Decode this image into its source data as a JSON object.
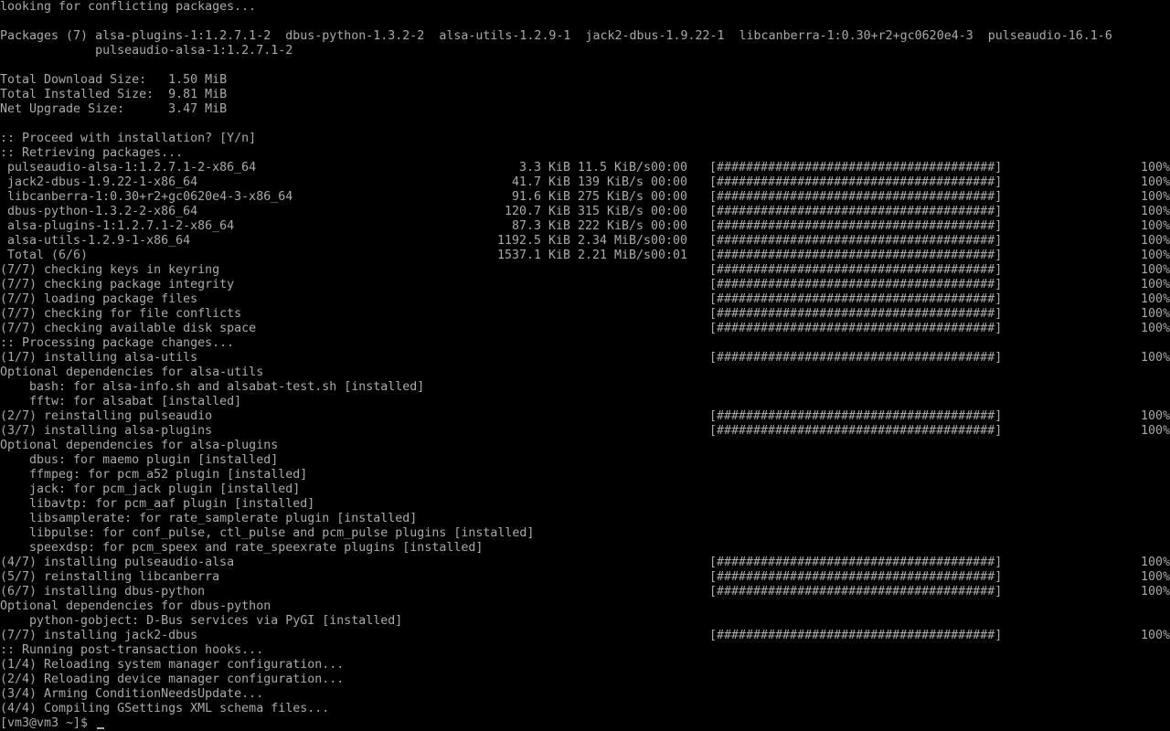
{
  "bar": "[######################################]",
  "bar_pct": "100%",
  "prompt": "[vm3@vm3 ~]$ ",
  "lines": [
    {
      "kind": "text",
      "text": "looking for conflicting packages..."
    },
    {
      "kind": "blank"
    },
    {
      "kind": "text",
      "text": "Packages (7) alsa-plugins-1:1.2.7.1-2  dbus-python-1.3.2-2  alsa-utils-1.2.9-1  jack2-dbus-1.9.22-1  libcanberra-1:0.30+r2+gc0620e4-3  pulseaudio-16.1-6"
    },
    {
      "kind": "text",
      "text": "             pulseaudio-alsa-1:1.2.7.1-2"
    },
    {
      "kind": "blank"
    },
    {
      "kind": "text",
      "text": "Total Download Size:   1.50 MiB"
    },
    {
      "kind": "text",
      "text": "Total Installed Size:  9.81 MiB"
    },
    {
      "kind": "text",
      "text": "Net Upgrade Size:      3.47 MiB"
    },
    {
      "kind": "blank"
    },
    {
      "kind": "text",
      "text": ":: Proceed with installation? [Y/n]"
    },
    {
      "kind": "text",
      "text": ":: Retrieving packages..."
    },
    {
      "kind": "dl",
      "name": " pulseaudio-alsa-1:1.2.7.1-2-x86_64",
      "size": "3.3 KiB",
      "rate": "11.5 KiB/s",
      "time": "00:00"
    },
    {
      "kind": "dl",
      "name": " jack2-dbus-1.9.22-1-x86_64",
      "size": "41.7 KiB",
      "rate": "139 KiB/s",
      "time": "00:00"
    },
    {
      "kind": "dl",
      "name": " libcanberra-1:0.30+r2+gc0620e4-3-x86_64",
      "size": "91.6 KiB",
      "rate": "275 KiB/s",
      "time": "00:00"
    },
    {
      "kind": "dl",
      "name": " dbus-python-1.3.2-2-x86_64",
      "size": "120.7 KiB",
      "rate": "315 KiB/s",
      "time": "00:00"
    },
    {
      "kind": "dl",
      "name": " alsa-plugins-1:1.2.7.1-2-x86_64",
      "size": "87.3 KiB",
      "rate": "222 KiB/s",
      "time": "00:00"
    },
    {
      "kind": "dl",
      "name": " alsa-utils-1.2.9-1-x86_64",
      "size": "1192.5 KiB",
      "rate": "2.34 MiB/s",
      "time": "00:00"
    },
    {
      "kind": "dl",
      "name": " Total (6/6)",
      "size": "1537.1 KiB",
      "rate": "2.21 MiB/s",
      "time": "00:01"
    },
    {
      "kind": "step",
      "text": "(7/7) checking keys in keyring"
    },
    {
      "kind": "step",
      "text": "(7/7) checking package integrity"
    },
    {
      "kind": "step",
      "text": "(7/7) loading package files"
    },
    {
      "kind": "step",
      "text": "(7/7) checking for file conflicts"
    },
    {
      "kind": "step",
      "text": "(7/7) checking available disk space"
    },
    {
      "kind": "text",
      "text": ":: Processing package changes..."
    },
    {
      "kind": "step",
      "text": "(1/7) installing alsa-utils"
    },
    {
      "kind": "text",
      "text": "Optional dependencies for alsa-utils"
    },
    {
      "kind": "text",
      "text": "    bash: for alsa-info.sh and alsabat-test.sh [installed]"
    },
    {
      "kind": "text",
      "text": "    fftw: for alsabat [installed]"
    },
    {
      "kind": "step",
      "text": "(2/7) reinstalling pulseaudio"
    },
    {
      "kind": "step",
      "text": "(3/7) installing alsa-plugins"
    },
    {
      "kind": "text",
      "text": "Optional dependencies for alsa-plugins"
    },
    {
      "kind": "text",
      "text": "    dbus: for maemo plugin [installed]"
    },
    {
      "kind": "text",
      "text": "    ffmpeg: for pcm_a52 plugin [installed]"
    },
    {
      "kind": "text",
      "text": "    jack: for pcm_jack plugin [installed]"
    },
    {
      "kind": "text",
      "text": "    libavtp: for pcm_aaf plugin [installed]"
    },
    {
      "kind": "text",
      "text": "    libsamplerate: for rate_samplerate plugin [installed]"
    },
    {
      "kind": "text",
      "text": "    libpulse: for conf_pulse, ctl_pulse and pcm_pulse plugins [installed]"
    },
    {
      "kind": "text",
      "text": "    speexdsp: for pcm_speex and rate_speexrate plugins [installed]"
    },
    {
      "kind": "step",
      "text": "(4/7) installing pulseaudio-alsa"
    },
    {
      "kind": "step",
      "text": "(5/7) reinstalling libcanberra"
    },
    {
      "kind": "step",
      "text": "(6/7) installing dbus-python"
    },
    {
      "kind": "text",
      "text": "Optional dependencies for dbus-python"
    },
    {
      "kind": "text",
      "text": "    python-gobject: D-Bus services via PyGI [installed]"
    },
    {
      "kind": "step",
      "text": "(7/7) installing jack2-dbus"
    },
    {
      "kind": "text",
      "text": ":: Running post-transaction hooks..."
    },
    {
      "kind": "text",
      "text": "(1/4) Reloading system manager configuration..."
    },
    {
      "kind": "text",
      "text": "(2/4) Reloading device manager configuration..."
    },
    {
      "kind": "text",
      "text": "(3/4) Arming ConditionNeedsUpdate..."
    },
    {
      "kind": "text",
      "text": "(4/4) Compiling GSettings XML schema files..."
    },
    {
      "kind": "prompt"
    }
  ]
}
